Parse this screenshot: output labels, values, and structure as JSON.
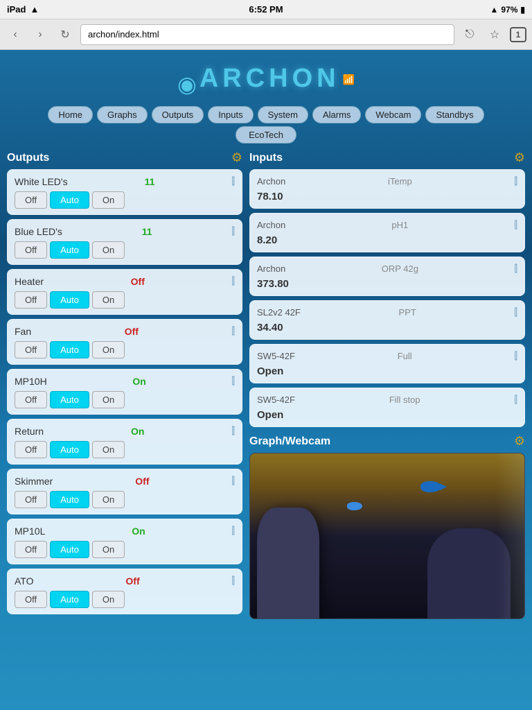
{
  "statusBar": {
    "left": [
      "iPad",
      "WiFi"
    ],
    "time": "6:52 PM",
    "right": [
      "signal",
      "97%"
    ]
  },
  "browser": {
    "url": "archon/index.html",
    "tabCount": "1",
    "back": "‹",
    "forward": "›",
    "reload": "↻",
    "share": "⎋",
    "bookmark": "☆"
  },
  "logo": {
    "text": "ARCHON"
  },
  "nav": {
    "items": [
      "Home",
      "Graphs",
      "Outputs",
      "Inputs",
      "System",
      "Alarms",
      "Webcam",
      "Standbys"
    ],
    "items2": [
      "EcoTech"
    ]
  },
  "outputs": {
    "title": "Outputs",
    "items": [
      {
        "name": "White LED's",
        "status": "11",
        "statusType": "green",
        "offLabel": "Off",
        "autoLabel": "Auto",
        "onLabel": "On",
        "activeBtn": "auto"
      },
      {
        "name": "Blue LED's",
        "status": "11",
        "statusType": "green",
        "offLabel": "Off",
        "autoLabel": "Auto",
        "onLabel": "On",
        "activeBtn": "auto"
      },
      {
        "name": "Heater",
        "status": "Off",
        "statusType": "red",
        "offLabel": "Off",
        "autoLabel": "Auto",
        "onLabel": "On",
        "activeBtn": "auto"
      },
      {
        "name": "Fan",
        "status": "Off",
        "statusType": "red",
        "offLabel": "Off",
        "autoLabel": "Auto",
        "onLabel": "On",
        "activeBtn": "auto"
      },
      {
        "name": "MP10H",
        "status": "On",
        "statusType": "green",
        "offLabel": "Off",
        "autoLabel": "Auto",
        "onLabel": "On",
        "activeBtn": "auto"
      },
      {
        "name": "Return",
        "status": "On",
        "statusType": "green",
        "offLabel": "Off",
        "autoLabel": "Auto",
        "onLabel": "On",
        "activeBtn": "auto"
      },
      {
        "name": "Skimmer",
        "status": "Off",
        "statusType": "red",
        "offLabel": "Off",
        "autoLabel": "Auto",
        "onLabel": "On",
        "activeBtn": "auto"
      },
      {
        "name": "MP10L",
        "status": "On",
        "statusType": "green",
        "offLabel": "Off",
        "autoLabel": "Auto",
        "onLabel": "On",
        "activeBtn": "auto"
      },
      {
        "name": "ATO",
        "status": "Off",
        "statusType": "red",
        "offLabel": "Off",
        "autoLabel": "Auto",
        "onLabel": "On",
        "activeBtn": "auto"
      }
    ]
  },
  "inputs": {
    "title": "Inputs",
    "items": [
      {
        "source": "Archon",
        "label": "iTemp",
        "value": "78.10"
      },
      {
        "source": "Archon",
        "label": "pH1",
        "value": "8.20"
      },
      {
        "source": "Archon",
        "label": "ORP 42g",
        "value": "373.80"
      },
      {
        "source": "SL2v2 42F",
        "label": "PPT",
        "value": "34.40"
      },
      {
        "source": "SW5-42F",
        "label": "Full",
        "value": "Open"
      },
      {
        "source": "SW5-42F",
        "label": "Fill stop",
        "value": "Open"
      }
    ]
  },
  "graph": {
    "title": "Graph/Webcam"
  },
  "icons": {
    "gear": "⚙",
    "sliders": "⫿",
    "gearSmall": "⚙"
  }
}
